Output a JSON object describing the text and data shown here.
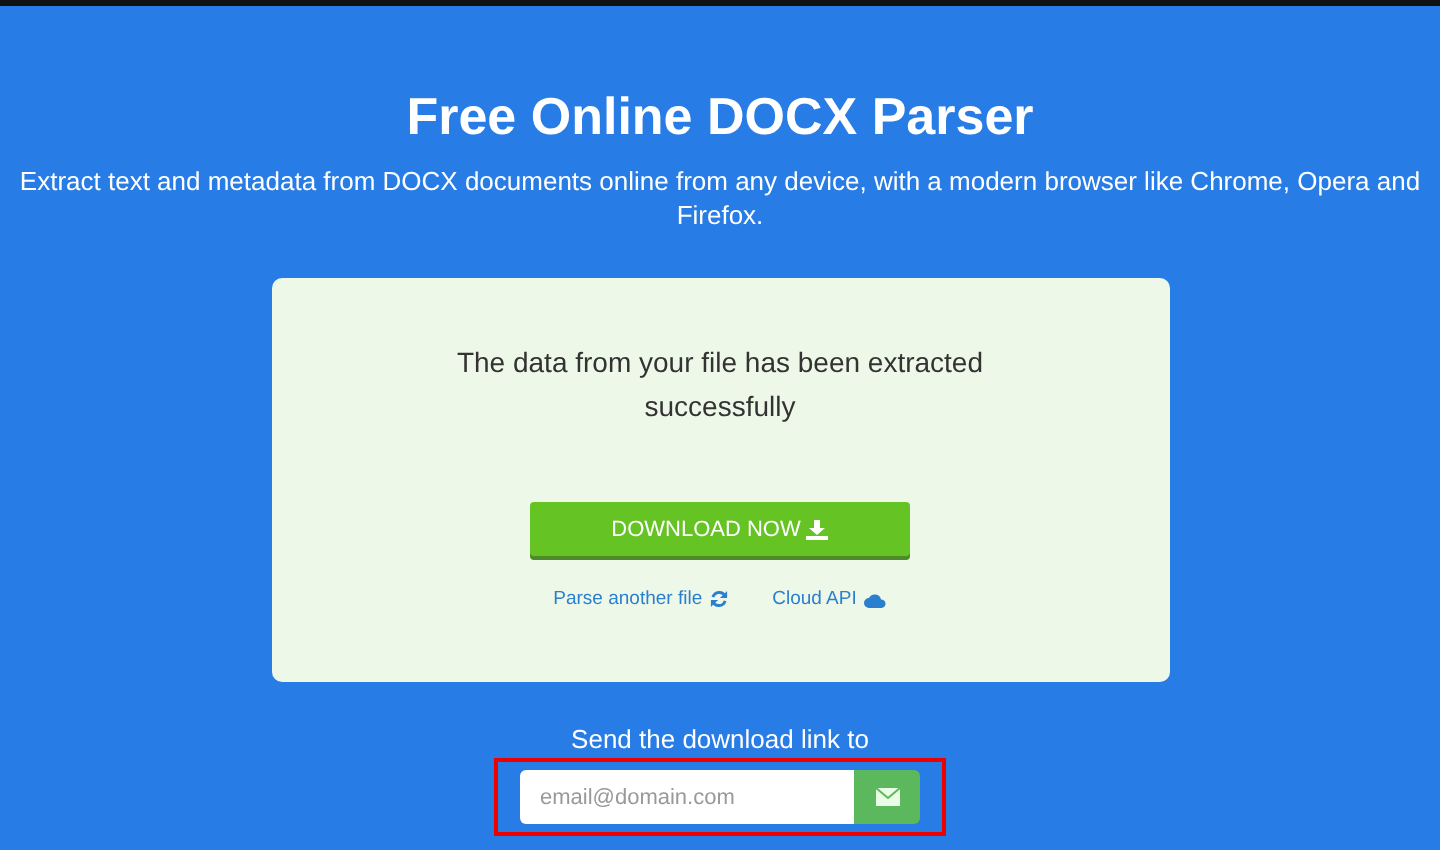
{
  "header": {
    "title": "Free Online DOCX Parser",
    "subtitle": "Extract text and metadata from DOCX documents online from any device, with a modern browser like Chrome, Opera and Firefox."
  },
  "result_card": {
    "message": "The data from your file has been extracted successfully",
    "download_button": "DOWNLOAD NOW",
    "links": [
      {
        "label": "Parse another file",
        "kind": "refresh"
      },
      {
        "label": "Cloud API",
        "kind": "cloud"
      }
    ]
  },
  "email_form": {
    "label": "Send the download link to",
    "placeholder": "email@domain.com",
    "highlighted": true
  }
}
